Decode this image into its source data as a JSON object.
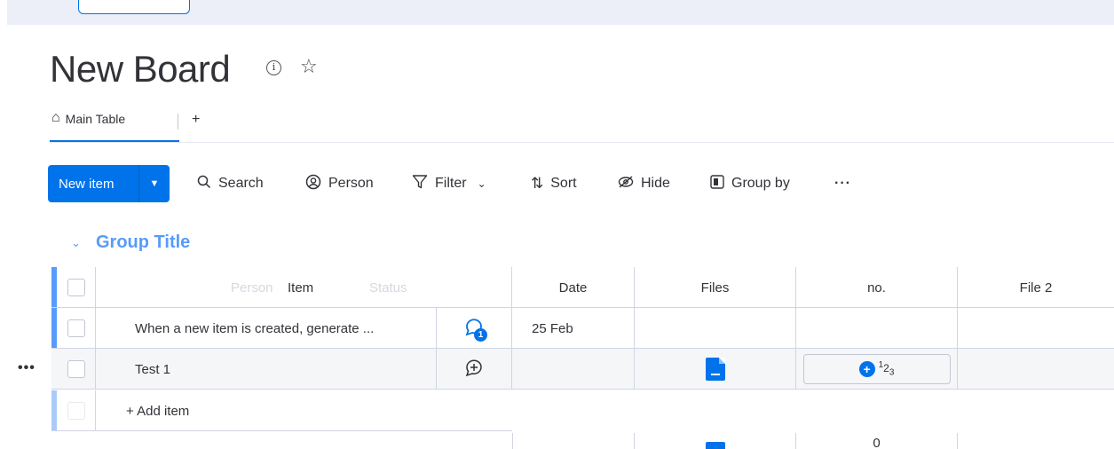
{
  "board": {
    "title": "New Board"
  },
  "tabs": {
    "main_label": "Main Table",
    "add_label": "+"
  },
  "toolbar": {
    "new_item": "New item",
    "search": "Search",
    "person": "Person",
    "filter": "Filter",
    "sort": "Sort",
    "hide": "Hide",
    "group_by": "Group by",
    "more": "···"
  },
  "group": {
    "title": "Group Title",
    "color": "#579bfc"
  },
  "table": {
    "columns": {
      "item": "Item",
      "person_ghost": "Person",
      "status_ghost": "Status",
      "date": "Date",
      "files": "Files",
      "number": "no.",
      "file2": "File 2"
    },
    "rows": [
      {
        "name": "When a new item is created, generate ...",
        "date": "25 Feb",
        "update_count": "1"
      },
      {
        "name": "Test 1",
        "date": ""
      }
    ],
    "add_item": "+ Add item",
    "summary_number": "0"
  },
  "colors": {
    "accent": "#0073ea"
  }
}
